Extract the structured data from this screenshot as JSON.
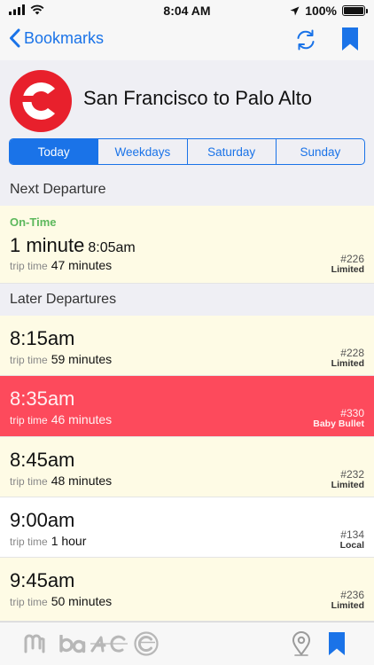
{
  "status_bar": {
    "time": "8:04 AM",
    "battery": "100%"
  },
  "nav": {
    "back_label": "Bookmarks"
  },
  "header": {
    "route": "San Francisco to Palo Alto"
  },
  "segments": [
    {
      "label": "Today",
      "active": true
    },
    {
      "label": "Weekdays",
      "active": false
    },
    {
      "label": "Saturday",
      "active": false
    },
    {
      "label": "Sunday",
      "active": false
    }
  ],
  "sections": {
    "next": "Next Departure",
    "later": "Later Departures"
  },
  "next_departure": {
    "status": "On-Time",
    "eta": "1 minute",
    "time": "8:05am",
    "trip_label": "trip time",
    "trip_time": "47 minutes",
    "train_no": "#226",
    "train_type": "Limited"
  },
  "later_departures": [
    {
      "time": "8:15am",
      "trip_label": "trip time",
      "trip_time": "59 minutes",
      "train_no": "#228",
      "train_type": "Limited",
      "style": "cream"
    },
    {
      "time": "8:35am",
      "trip_label": "trip time",
      "trip_time": "46 minutes",
      "train_no": "#330",
      "train_type": "Baby Bullet",
      "style": "red"
    },
    {
      "time": "8:45am",
      "trip_label": "trip time",
      "trip_time": "48 minutes",
      "train_no": "#232",
      "train_type": "Limited",
      "style": "cream"
    },
    {
      "time": "9:00am",
      "trip_label": "trip time",
      "trip_time": "1 hour",
      "train_no": "#134",
      "train_type": "Local",
      "style": "white"
    },
    {
      "time": "9:45am",
      "trip_label": "trip time",
      "trip_time": "50 minutes",
      "train_no": "#236",
      "train_type": "Limited",
      "style": "cream"
    }
  ],
  "icons": {
    "accent": "#1a73e8",
    "brand_red": "#e8202c",
    "tabs": [
      "muni-icon",
      "bart-icon",
      "ac-transit-icon",
      "caltrain-icon",
      "map-pin-icon",
      "bookmark-icon"
    ]
  }
}
